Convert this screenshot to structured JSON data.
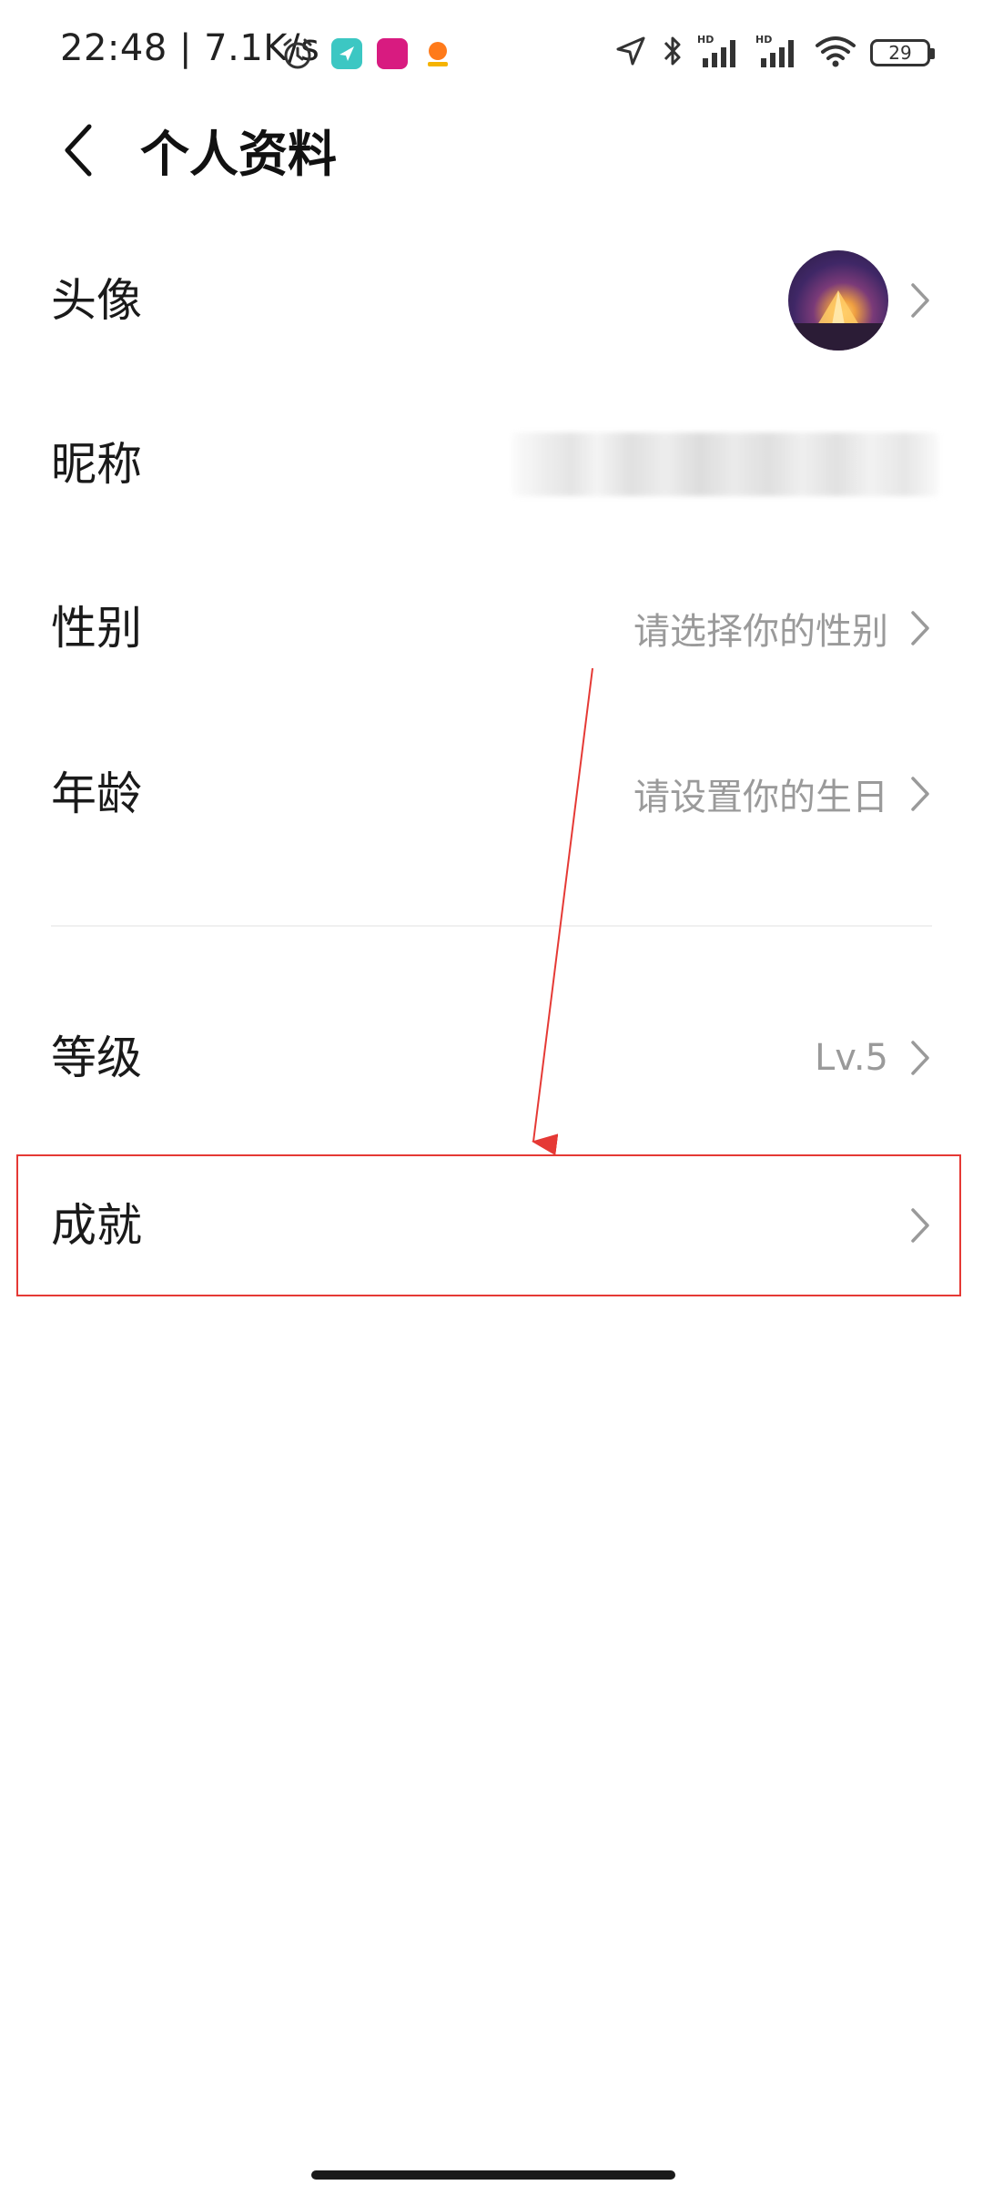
{
  "status_bar": {
    "time_speed": "22:48 | 7.1K/s",
    "battery": "29",
    "icons": [
      "alarm-icon",
      "app-send-icon",
      "app-vip-icon",
      "app-orange-icon",
      "location-icon",
      "bluetooth-icon",
      "signal-hd-icon",
      "signal-hd-icon",
      "wifi-icon",
      "battery-icon"
    ]
  },
  "header": {
    "title": "个人资料"
  },
  "rows": [
    {
      "label": "头像",
      "value": "",
      "kind": "avatar"
    },
    {
      "label": "昵称",
      "value": "",
      "kind": "nickname"
    },
    {
      "label": "性别",
      "value": "请选择你的性别",
      "kind": "text"
    },
    {
      "label": "年龄",
      "value": "请设置你的生日",
      "kind": "text"
    },
    {
      "label": "等级",
      "value": "Lv.5",
      "kind": "text"
    },
    {
      "label": "成就",
      "value": "",
      "kind": "link"
    }
  ],
  "colors": {
    "text_primary": "#1a1a1a",
    "text_secondary": "#9a9a9a",
    "divider": "#f0f0f0",
    "annotation": "#e53935"
  }
}
